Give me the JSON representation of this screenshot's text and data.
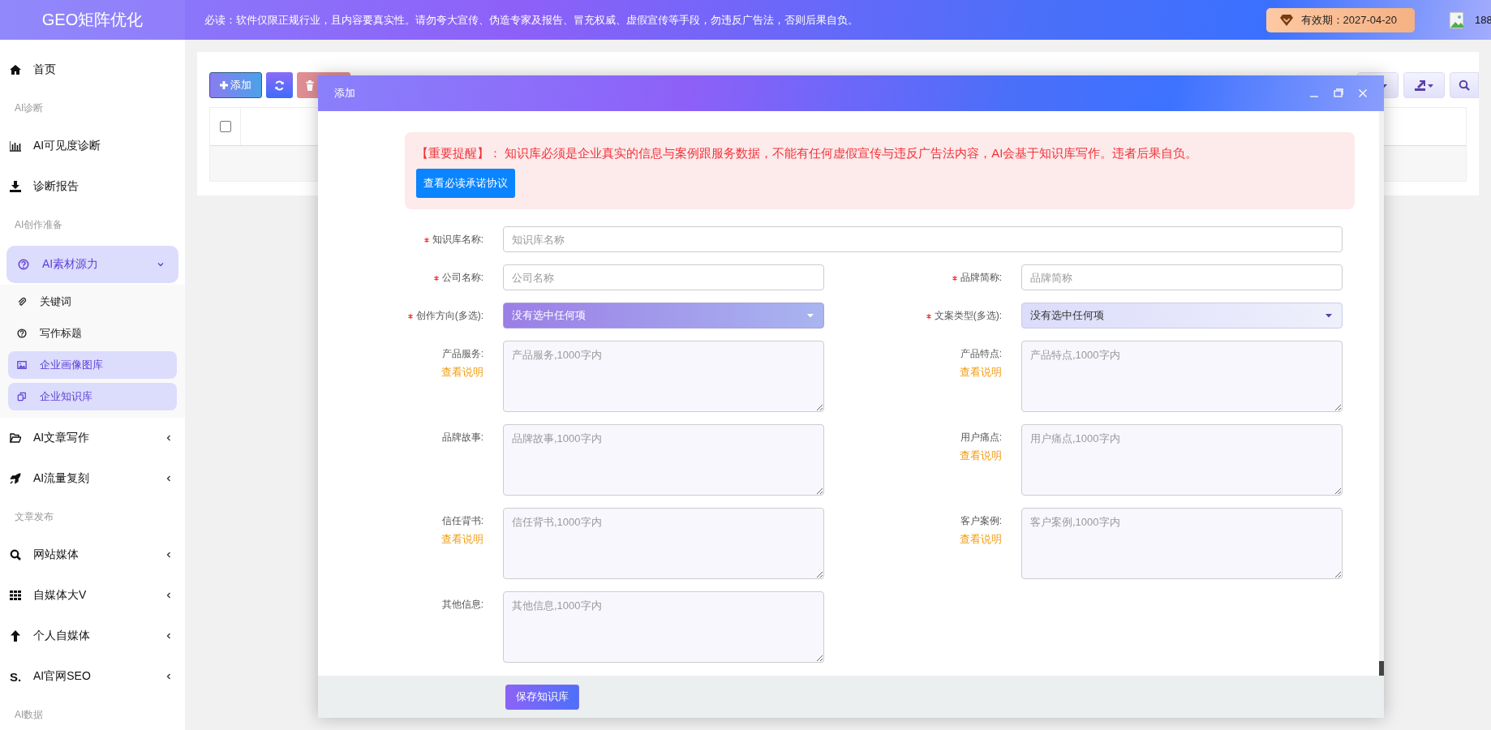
{
  "topbar": {
    "logo": "GEO矩阵优化",
    "notice": "必读：软件仅限正规行业，且内容要真实性。请勿夸大宣传、伪造专家及报告、冒充权威、虚假宣传等手段，勿违反广告法，否则后果自负。",
    "validity": "有效期：2027-04-20",
    "user": "188"
  },
  "sidebar": {
    "items": [
      {
        "kind": "link",
        "label": "首页",
        "selected": false
      },
      {
        "kind": "section",
        "label": "AI诊断"
      },
      {
        "kind": "link",
        "label": "AI可见度诊断",
        "selected": false
      },
      {
        "kind": "link",
        "label": "诊断报告",
        "selected": false
      },
      {
        "kind": "section",
        "label": "AI创作准备"
      },
      {
        "kind": "group",
        "label": "AI素材源力",
        "expanded": true,
        "children": [
          {
            "label": "关键词",
            "selected": false
          },
          {
            "label": "写作标题",
            "selected": false
          },
          {
            "label": "企业画像图库",
            "selected": true
          },
          {
            "label": "企业知识库",
            "selected": true
          }
        ]
      },
      {
        "kind": "group",
        "label": "AI文章写作",
        "expanded": false
      },
      {
        "kind": "group",
        "label": "AI流量复刻",
        "expanded": false
      },
      {
        "kind": "section",
        "label": "文章发布"
      },
      {
        "kind": "group",
        "label": "网站媒体",
        "expanded": false
      },
      {
        "kind": "group",
        "label": "自媒体大V",
        "expanded": false
      },
      {
        "kind": "group",
        "label": "个人自媒体",
        "expanded": false
      },
      {
        "kind": "group",
        "label": "AI官网SEO",
        "expanded": false,
        "glyph": "S."
      },
      {
        "kind": "section",
        "label": "AI数据"
      }
    ]
  },
  "toolbar": {
    "add_button": "添加"
  },
  "table": {
    "select_all": {
      "checked": false
    }
  },
  "modal": {
    "title": "添加",
    "alert": {
      "text": "【重要提醒】： 知识库必须是企业真实的信息与案例跟服务数据，不能有任何虚假宣传与违反广告法内容，AI会基于知识库写作。违者后果自负。",
      "button": "查看必读承诺协议"
    },
    "fields": [
      {
        "kind": "input",
        "label": "知识库名称:",
        "required": true,
        "placeholder": "知识库名称",
        "wide": true
      },
      {
        "kind": "input",
        "label": "公司名称:",
        "required": true,
        "placeholder": "公司名称"
      },
      {
        "kind": "input",
        "label": "品牌简称:",
        "required": true,
        "placeholder": "品牌简称"
      },
      {
        "kind": "select",
        "label": "创作方向(多选):",
        "required": true,
        "value": "没有选中任何项",
        "focused": true
      },
      {
        "kind": "select",
        "label": "文案类型(多选):",
        "required": true,
        "value": "没有选中任何项",
        "focused": false
      },
      {
        "kind": "textarea",
        "label": "产品服务:",
        "required": false,
        "placeholder": "产品服务,1000字内",
        "help": "查看说明"
      },
      {
        "kind": "textarea",
        "label": "产品特点:",
        "required": false,
        "placeholder": "产品特点,1000字内",
        "help": "查看说明"
      },
      {
        "kind": "textarea",
        "label": "品牌故事:",
        "required": false,
        "placeholder": "品牌故事,1000字内"
      },
      {
        "kind": "textarea",
        "label": "用户痛点:",
        "required": false,
        "placeholder": "用户痛点,1000字内",
        "help": "查看说明"
      },
      {
        "kind": "textarea",
        "label": "信任背书:",
        "required": false,
        "placeholder": "信任背书,1000字内",
        "help": "查看说明"
      },
      {
        "kind": "textarea",
        "label": "客户案例:",
        "required": false,
        "placeholder": "客户案例,1000字内",
        "help": "查看说明"
      },
      {
        "kind": "textarea",
        "label": "其他信息:",
        "required": false,
        "placeholder": "其他信息,1000字内"
      }
    ],
    "save_button": "保存知识库"
  }
}
